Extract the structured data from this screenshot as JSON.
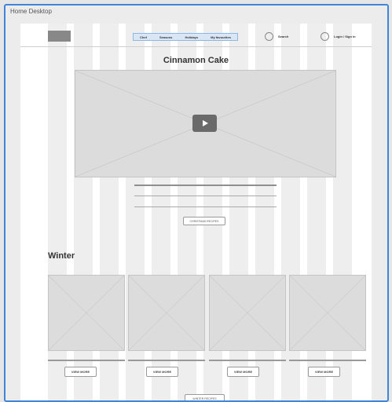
{
  "window": {
    "title": "Home Desktop"
  },
  "nav": {
    "items": [
      "Chef",
      "Seasons",
      "Holidays",
      "My favourites"
    ],
    "search_label": "Search",
    "login_label": "Login / Sign in"
  },
  "hero": {
    "heading": "Cinnamon Cake",
    "cta_label": "CHRISTMAS RECIPES"
  },
  "winter": {
    "heading": "Winter",
    "cards": [
      {
        "button_label": "VIEW MORE"
      },
      {
        "button_label": "VIEW MORE"
      },
      {
        "button_label": "VIEW MORE"
      },
      {
        "button_label": "VIEW MORE"
      }
    ],
    "cta_label": "WINTER RECIPES"
  },
  "colors": {
    "selection_border": "#3f86d8",
    "nav_highlight": "#d8e6f6",
    "placeholder_fill": "#dcdcdc"
  }
}
